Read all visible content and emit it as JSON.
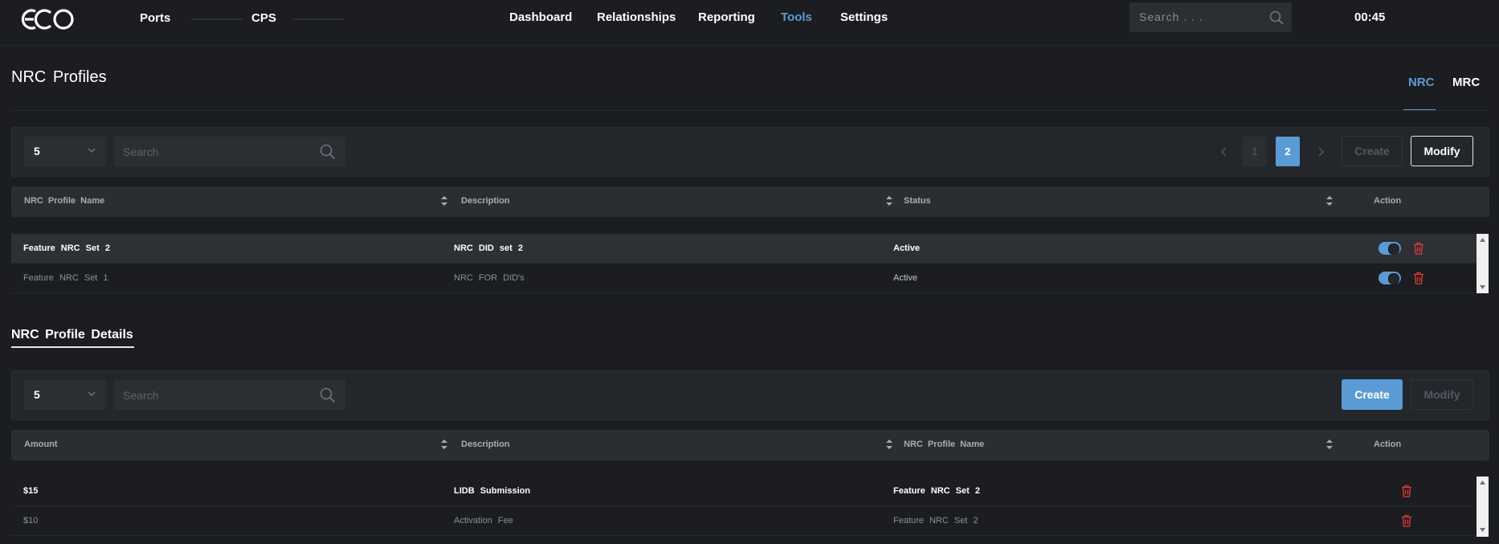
{
  "app": {
    "logo_text": "ECO",
    "clock": "00:45"
  },
  "nav": {
    "meters": [
      "Ports",
      "CPS"
    ],
    "links": [
      "Dashboard",
      "Relationships",
      "Reporting",
      "Tools",
      "Settings"
    ],
    "active": "Tools",
    "search_placeholder": "Search . . ."
  },
  "page": {
    "title": "NRC Profiles",
    "tabs": [
      "NRC",
      "MRC"
    ],
    "active_tab": "NRC"
  },
  "profiles": {
    "page_size": "5",
    "search_placeholder": "Search",
    "pages": [
      "1",
      "2"
    ],
    "current_page": "2",
    "create_label": "Create",
    "modify_label": "Modify",
    "columns": [
      "NRC Profile Name",
      "Description",
      "Status",
      "Action"
    ],
    "rows": [
      {
        "name": "Feature NRC Set 2",
        "description": "NRC DID set 2",
        "status": "Active",
        "enabled": true,
        "selected": true
      },
      {
        "name": "Feature NRC Set 1",
        "description": "NRC FOR DID's",
        "status": "Active",
        "enabled": true,
        "selected": false
      }
    ]
  },
  "details": {
    "title": "NRC Profile Details",
    "page_size": "5",
    "search_placeholder": "Search",
    "create_label": "Create",
    "modify_label": "Modify",
    "columns": [
      "Amount",
      "Description",
      "NRC Profile Name",
      "Action"
    ],
    "rows": [
      {
        "amount": "$15",
        "description": "LIDB Submission",
        "profile": "Feature NRC Set 2"
      },
      {
        "amount": "$10",
        "description": "Activation Fee",
        "profile": "Feature NRC Set 2"
      }
    ]
  },
  "colors": {
    "accent": "#5b9bd5",
    "danger": "#e23b3b",
    "background": "#1b1d21"
  }
}
